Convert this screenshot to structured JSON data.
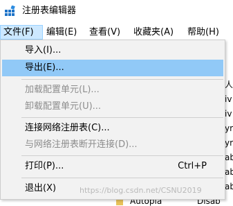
{
  "window": {
    "title": "注册表编辑器",
    "icon": "registry-editor-icon"
  },
  "menubar": {
    "items": [
      "文件(F)",
      "编辑(E)",
      "查看(V)",
      "收藏夹(A)",
      "帮助(H)"
    ],
    "open_index": 0
  },
  "file_menu": {
    "items": [
      {
        "label": "导入(I)...",
        "enabled": true
      },
      {
        "label": "导出(E)...",
        "enabled": true,
        "highlighted": true
      },
      {
        "label": "加载配置单元(L)...",
        "enabled": false
      },
      {
        "label": "卸载配置单元(U)...",
        "enabled": false
      },
      {
        "label": "连接网络注册表(C)...",
        "enabled": true
      },
      {
        "label": "与网络注册表断开连接(D)...",
        "enabled": false
      },
      {
        "label": "打印(P)...",
        "enabled": true,
        "shortcut": "Ctrl+P"
      },
      {
        "label": "退出(X)",
        "enabled": true
      }
    ]
  },
  "background": {
    "right_column_fragments": [
      "人",
      "iv",
      "iv",
      "yr",
      "yr",
      "ab",
      "ab",
      "ab"
    ],
    "tree_fragment": "Autopla",
    "value_fragment": "Disab",
    "watermark": "https://blog.csdn.net/CSNU2019"
  },
  "colors": {
    "menu_background": "#f2f2f2",
    "highlight": "#91c9f7",
    "open_menu": "#cce8ff",
    "disabled_text": "#8d8d8d"
  }
}
